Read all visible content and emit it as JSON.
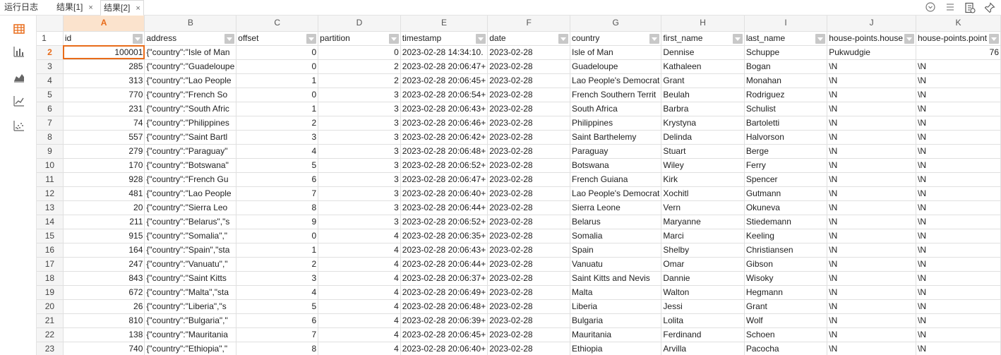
{
  "tabs": {
    "log": "运行日志",
    "result1": "结果[1]",
    "result2": "结果[2]",
    "close": "×"
  },
  "left_toolbar": [
    "table-icon",
    "bar-chart-icon",
    "area-chart-icon",
    "line-chart-icon",
    "scatter-chart-icon"
  ],
  "top_icons": [
    "clock-icon",
    "list-icon",
    "export-icon",
    "pin-icon"
  ],
  "accent": "#e86c1a",
  "columns": [
    "A",
    "B",
    "C",
    "D",
    "E",
    "F",
    "G",
    "H",
    "I",
    "J",
    "K"
  ],
  "fields": [
    "id",
    "address",
    "offset",
    "partition",
    "timestamp",
    "date",
    "country",
    "first_name",
    "last_name",
    "house-points.house",
    "house-points.point"
  ],
  "rows": [
    {
      "n": "2",
      "id": "100001",
      "address": "{\"country\":\"Isle of Man",
      "offset": "0",
      "partition": "0",
      "timestamp": "2023-02-28 14:34:10.",
      "date": "2023-02-28",
      "country": "Isle of Man",
      "first_name": "Dennise",
      "last_name": "Schuppe",
      "house": "Pukwudgie",
      "points": "76"
    },
    {
      "n": "3",
      "id": "285",
      "address": "{\"country\":\"Guadeloupe",
      "offset": "0",
      "partition": "2",
      "timestamp": "2023-02-28 20:06:47+",
      "date": "2023-02-28",
      "country": "Guadeloupe",
      "first_name": "Kathaleen",
      "last_name": "Bogan",
      "house": "\\N",
      "points": "\\N"
    },
    {
      "n": "4",
      "id": "313",
      "address": "{\"country\":\"Lao People",
      "offset": "1",
      "partition": "2",
      "timestamp": "2023-02-28 20:06:45+",
      "date": "2023-02-28",
      "country": "Lao People's Democrat",
      "first_name": "Grant",
      "last_name": "Monahan",
      "house": "\\N",
      "points": "\\N"
    },
    {
      "n": "5",
      "id": "770",
      "address": "{\"country\":\"French So",
      "offset": "0",
      "partition": "3",
      "timestamp": "2023-02-28 20:06:54+",
      "date": "2023-02-28",
      "country": "French Southern Territ",
      "first_name": "Beulah",
      "last_name": "Rodriguez",
      "house": "\\N",
      "points": "\\N"
    },
    {
      "n": "6",
      "id": "231",
      "address": "{\"country\":\"South Afric",
      "offset": "1",
      "partition": "3",
      "timestamp": "2023-02-28 20:06:43+",
      "date": "2023-02-28",
      "country": "South Africa",
      "first_name": "Barbra",
      "last_name": "Schulist",
      "house": "\\N",
      "points": "\\N"
    },
    {
      "n": "7",
      "id": "74",
      "address": "{\"country\":\"Philippines",
      "offset": "2",
      "partition": "3",
      "timestamp": "2023-02-28 20:06:46+",
      "date": "2023-02-28",
      "country": "Philippines",
      "first_name": "Krystyna",
      "last_name": "Bartoletti",
      "house": "\\N",
      "points": "\\N"
    },
    {
      "n": "8",
      "id": "557",
      "address": "{\"country\":\"Saint Bartl",
      "offset": "3",
      "partition": "3",
      "timestamp": "2023-02-28 20:06:42+",
      "date": "2023-02-28",
      "country": "Saint Barthelemy",
      "first_name": "Delinda",
      "last_name": "Halvorson",
      "house": "\\N",
      "points": "\\N"
    },
    {
      "n": "9",
      "id": "279",
      "address": "{\"country\":\"Paraguay\"",
      "offset": "4",
      "partition": "3",
      "timestamp": "2023-02-28 20:06:48+",
      "date": "2023-02-28",
      "country": "Paraguay",
      "first_name": "Stuart",
      "last_name": "Berge",
      "house": "\\N",
      "points": "\\N"
    },
    {
      "n": "10",
      "id": "170",
      "address": "{\"country\":\"Botswana\"",
      "offset": "5",
      "partition": "3",
      "timestamp": "2023-02-28 20:06:52+",
      "date": "2023-02-28",
      "country": "Botswana",
      "first_name": "Wiley",
      "last_name": "Ferry",
      "house": "\\N",
      "points": "\\N"
    },
    {
      "n": "11",
      "id": "928",
      "address": "{\"country\":\"French Gu",
      "offset": "6",
      "partition": "3",
      "timestamp": "2023-02-28 20:06:47+",
      "date": "2023-02-28",
      "country": "French Guiana",
      "first_name": "Kirk",
      "last_name": "Spencer",
      "house": "\\N",
      "points": "\\N"
    },
    {
      "n": "12",
      "id": "481",
      "address": "{\"country\":\"Lao People",
      "offset": "7",
      "partition": "3",
      "timestamp": "2023-02-28 20:06:40+",
      "date": "2023-02-28",
      "country": "Lao People's Democrat",
      "first_name": "Xochitl",
      "last_name": "Gutmann",
      "house": "\\N",
      "points": "\\N"
    },
    {
      "n": "13",
      "id": "20",
      "address": "{\"country\":\"Sierra Leo",
      "offset": "8",
      "partition": "3",
      "timestamp": "2023-02-28 20:06:44+",
      "date": "2023-02-28",
      "country": "Sierra Leone",
      "first_name": "Vern",
      "last_name": "Okuneva",
      "house": "\\N",
      "points": "\\N"
    },
    {
      "n": "14",
      "id": "211",
      "address": "{\"country\":\"Belarus\",\"s",
      "offset": "9",
      "partition": "3",
      "timestamp": "2023-02-28 20:06:52+",
      "date": "2023-02-28",
      "country": "Belarus",
      "first_name": "Maryanne",
      "last_name": "Stiedemann",
      "house": "\\N",
      "points": "\\N"
    },
    {
      "n": "15",
      "id": "915",
      "address": "{\"country\":\"Somalia\",\"",
      "offset": "0",
      "partition": "4",
      "timestamp": "2023-02-28 20:06:35+",
      "date": "2023-02-28",
      "country": "Somalia",
      "first_name": "Marci",
      "last_name": "Keeling",
      "house": "\\N",
      "points": "\\N"
    },
    {
      "n": "16",
      "id": "164",
      "address": "{\"country\":\"Spain\",\"sta",
      "offset": "1",
      "partition": "4",
      "timestamp": "2023-02-28 20:06:43+",
      "date": "2023-02-28",
      "country": "Spain",
      "first_name": "Shelby",
      "last_name": "Christiansen",
      "house": "\\N",
      "points": "\\N"
    },
    {
      "n": "17",
      "id": "247",
      "address": "{\"country\":\"Vanuatu\",\"",
      "offset": "2",
      "partition": "4",
      "timestamp": "2023-02-28 20:06:44+",
      "date": "2023-02-28",
      "country": "Vanuatu",
      "first_name": "Omar",
      "last_name": "Gibson",
      "house": "\\N",
      "points": "\\N"
    },
    {
      "n": "18",
      "id": "843",
      "address": "{\"country\":\"Saint Kitts",
      "offset": "3",
      "partition": "4",
      "timestamp": "2023-02-28 20:06:37+",
      "date": "2023-02-28",
      "country": "Saint Kitts and Nevis",
      "first_name": "Dannie",
      "last_name": "Wisoky",
      "house": "\\N",
      "points": "\\N"
    },
    {
      "n": "19",
      "id": "672",
      "address": "{\"country\":\"Malta\",\"sta",
      "offset": "4",
      "partition": "4",
      "timestamp": "2023-02-28 20:06:49+",
      "date": "2023-02-28",
      "country": "Malta",
      "first_name": "Walton",
      "last_name": "Hegmann",
      "house": "\\N",
      "points": "\\N"
    },
    {
      "n": "20",
      "id": "26",
      "address": "{\"country\":\"Liberia\",\"s",
      "offset": "5",
      "partition": "4",
      "timestamp": "2023-02-28 20:06:48+",
      "date": "2023-02-28",
      "country": "Liberia",
      "first_name": "Jessi",
      "last_name": "Grant",
      "house": "\\N",
      "points": "\\N"
    },
    {
      "n": "21",
      "id": "810",
      "address": "{\"country\":\"Bulgaria\",\"",
      "offset": "6",
      "partition": "4",
      "timestamp": "2023-02-28 20:06:39+",
      "date": "2023-02-28",
      "country": "Bulgaria",
      "first_name": "Lolita",
      "last_name": "Wolf",
      "house": "\\N",
      "points": "\\N"
    },
    {
      "n": "22",
      "id": "138",
      "address": "{\"country\":\"Mauritania",
      "offset": "7",
      "partition": "4",
      "timestamp": "2023-02-28 20:06:45+",
      "date": "2023-02-28",
      "country": "Mauritania",
      "first_name": "Ferdinand",
      "last_name": "Schoen",
      "house": "\\N",
      "points": "\\N"
    },
    {
      "n": "23",
      "id": "740",
      "address": "{\"country\":\"Ethiopia\",\"",
      "offset": "8",
      "partition": "4",
      "timestamp": "2023-02-28 20:06:40+",
      "date": "2023-02-28",
      "country": "Ethiopia",
      "first_name": "Arvilla",
      "last_name": "Pacocha",
      "house": "\\N",
      "points": "\\N"
    }
  ]
}
